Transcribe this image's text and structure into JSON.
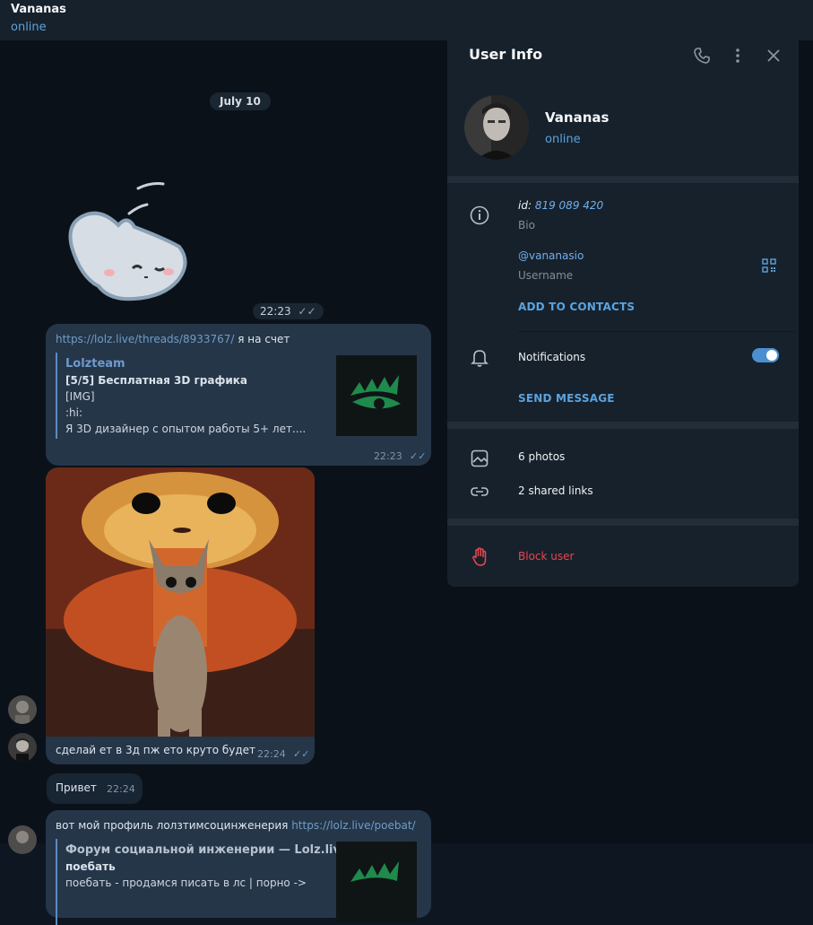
{
  "chat": {
    "name": "Vananas",
    "status": "online",
    "date": "July 10",
    "messages": [
      {
        "time": "22:23"
      },
      {
        "link": "https://lolz.live/threads/8933767/",
        "text": " я на счет",
        "preview": {
          "site": "Lolzteam",
          "title": "[5/5] Бесплатная 3D графика",
          "lines": [
            "[IMG]",
            ":hi:",
            "Я 3D дизайнер с опытом работы 5+ лет...."
          ]
        },
        "time": "22:23"
      },
      {
        "caption": "сделай ет в 3д пж ето круто будет",
        "time": "22:24"
      },
      {
        "text": "Привет",
        "time": "22:24"
      },
      {
        "text": "вот мой профиль лолзтимсоцинженерия ",
        "link": "https://lolz.live/poebat/",
        "preview": {
          "site": "Форум социальной инженерии — Lolz.live...",
          "title": "поебать",
          "line": "поебать - продамся писать в лс | порно ->"
        }
      }
    ]
  },
  "panel": {
    "title": "User Info",
    "name": "Vananas",
    "status": "online",
    "id_label": "id:",
    "id_value": "819 089 420",
    "bio_label": "Bio",
    "username": "@vananasio",
    "username_label": "Username",
    "add_contacts": "ADD TO CONTACTS",
    "notifications": "Notifications",
    "notifications_on": true,
    "send_message": "SEND MESSAGE",
    "photos": "6 photos",
    "links": "2 shared links",
    "block": "Block user"
  },
  "colors": {
    "accent": "#5aa3e0",
    "danger": "#e8474f",
    "panel_bg": "#17212b",
    "chat_bg": "#0b1119"
  }
}
